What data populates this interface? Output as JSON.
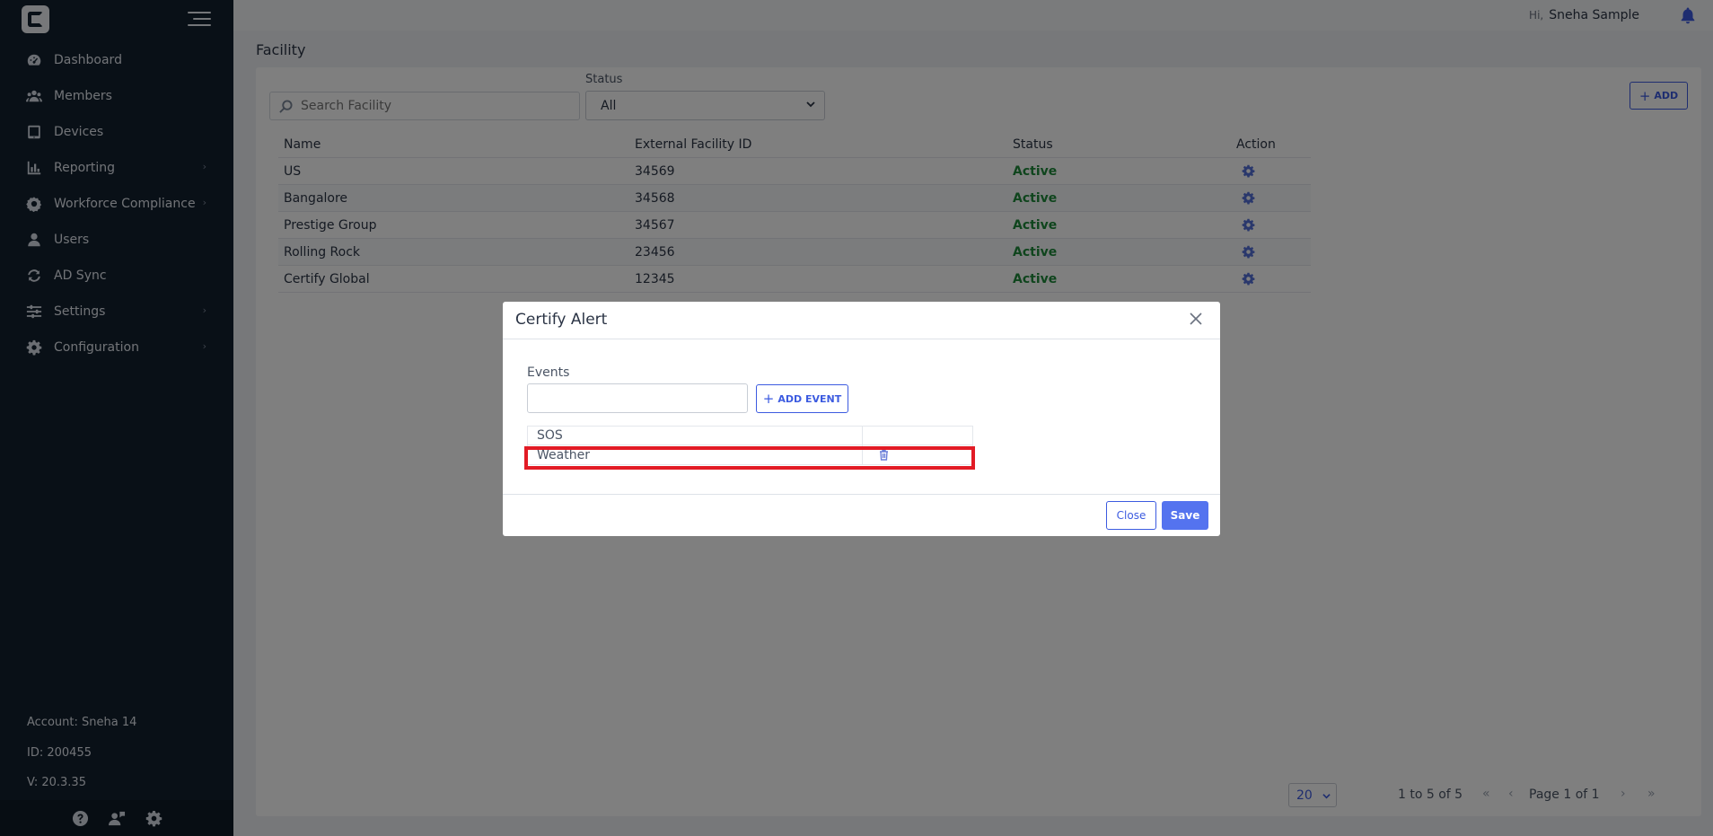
{
  "sidebar": {
    "items": [
      {
        "label": "Dashboard",
        "icon": "dashboard-icon"
      },
      {
        "label": "Members",
        "icon": "members-icon"
      },
      {
        "label": "Devices",
        "icon": "tablet-icon"
      },
      {
        "label": "Reporting",
        "icon": "bar-chart-icon",
        "has_submenu": true
      },
      {
        "label": "Workforce Compliance",
        "icon": "cog-badge-icon",
        "has_submenu": true
      },
      {
        "label": "Users",
        "icon": "user-icon"
      },
      {
        "label": "AD Sync",
        "icon": "sync-icon"
      },
      {
        "label": "Settings",
        "icon": "sliders-icon",
        "has_submenu": true
      },
      {
        "label": "Configuration",
        "icon": "gear-icon",
        "has_submenu": true
      }
    ],
    "account": "Account: Sneha 14",
    "id": "ID: 200455",
    "version": "V: 20.3.35",
    "chevron": "›"
  },
  "topbar": {
    "greeting_prefix": "Hi,",
    "user_name": "Sneha Sample"
  },
  "page": {
    "title": "Facility",
    "search_placeholder": "Search Facility",
    "status_label": "Status",
    "status_value": "All",
    "add_label": "ADD"
  },
  "table": {
    "headers": [
      "Name",
      "External Facility ID",
      "Status",
      "Action"
    ],
    "rows": [
      {
        "name": "US",
        "ext_id": "34569",
        "status": "Active"
      },
      {
        "name": "Bangalore",
        "ext_id": "34568",
        "status": "Active"
      },
      {
        "name": "Prestige Group",
        "ext_id": "34567",
        "status": "Active"
      },
      {
        "name": "Rolling Rock",
        "ext_id": "23456",
        "status": "Active"
      },
      {
        "name": "Certify Global",
        "ext_id": "12345",
        "status": "Active"
      }
    ]
  },
  "pagination": {
    "page_size": "20",
    "range": "1 to 5 of 5",
    "page_of": "Page 1 of 1",
    "first": "«",
    "prev": "‹",
    "next": "›",
    "last": "»"
  },
  "modal": {
    "title": "Certify Alert",
    "events_label": "Events",
    "event_input_value": "",
    "add_event_label": "ADD EVENT",
    "events": [
      "SOS",
      "Weather"
    ],
    "close_label": "Close",
    "save_label": "Save"
  },
  "colors": {
    "sidebar_bg": "#13202f",
    "accent": "#3c5be0",
    "active_status": "#1f8a3b",
    "highlight": "#e21b25"
  }
}
